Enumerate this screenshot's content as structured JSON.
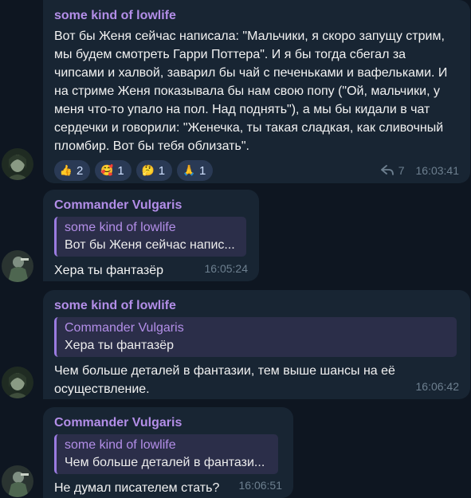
{
  "messages": [
    {
      "sender": "some kind of lowlife",
      "text": "Вот бы Женя сейчас написала: \"Мальчики, я скоро запущу стрим, мы будем смотреть Гарри Поттера\". И я бы тогда сбегал за чипсами и халвой, заварил бы чай с печеньками и вафельками. И на стриме Женя показывала бы нам свою попу (\"Ой, мальчики, у меня что-то упало на пол. Над поднять\"), а мы бы кидали в чат сердечки и говорили: \"Женечка, ты такая сладкая, как сливочный пломбир. Вот бы тебя облизать\".",
      "reactions": [
        {
          "emoji": "👍",
          "count": "2",
          "icon": "thumbs-up-icon"
        },
        {
          "emoji": "🥰",
          "count": "1",
          "icon": "smiling-hearts-icon"
        },
        {
          "emoji": "🤔",
          "count": "1",
          "icon": "thinking-face-icon"
        },
        {
          "emoji": "🙏",
          "count": "1",
          "icon": "praying-hands-icon"
        }
      ],
      "forwards": "7",
      "time": "16:03:41"
    },
    {
      "sender": "Commander Vulgaris",
      "quote_sender": "some kind of lowlife",
      "quote_text": "Вот бы Женя сейчас напис...",
      "text": "Хера ты фантазёр",
      "time": "16:05:24"
    },
    {
      "sender": "some kind of lowlife",
      "quote_sender": "Commander Vulgaris",
      "quote_text": "Хера ты фантазёр",
      "text": "Чем больше деталей в фантазии, тем выше шансы на её осуществление.",
      "time": "16:06:42"
    },
    {
      "sender": "Commander Vulgaris",
      "quote_sender": "some kind of lowlife",
      "quote_text": "Чем больше деталей в фантази...",
      "text": "Не думал писателем стать?",
      "time": "16:06:51"
    }
  ],
  "colors": {
    "background": "#0e1621",
    "bubble": "#182533",
    "sender": "#b38ee8",
    "quote_bg": "#2b2e49",
    "reaction_bg": "#2a3a55",
    "time": "#6d7f8f"
  },
  "icons": {
    "forward": "forward-arrow-icon",
    "avatar_lowlife": "avatar-lowlife",
    "avatar_commander": "avatar-commander"
  }
}
